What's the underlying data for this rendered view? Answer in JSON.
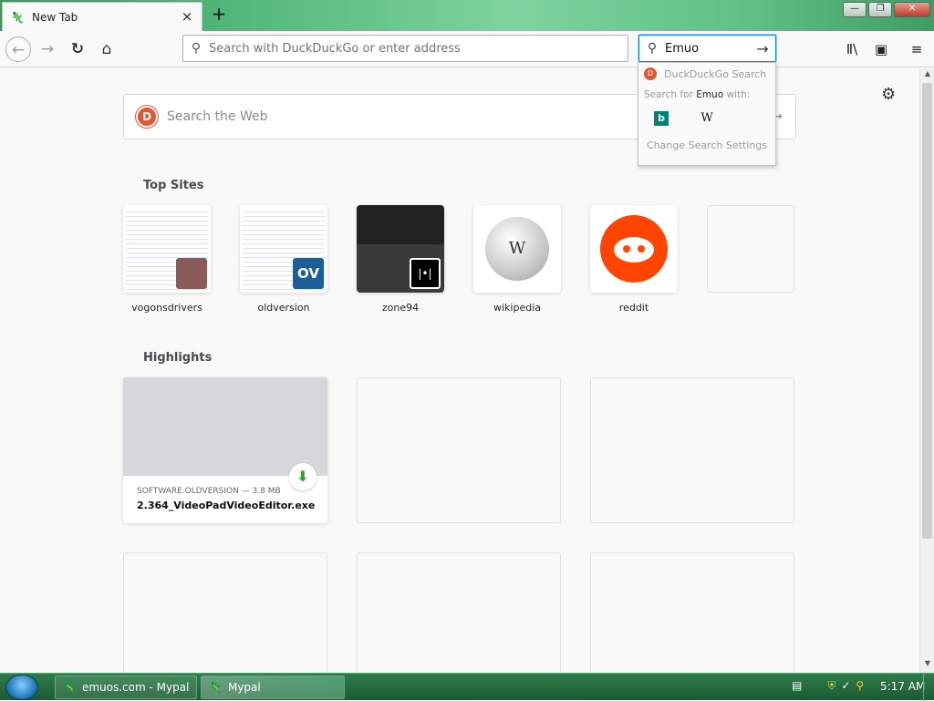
{
  "tab": {
    "icon": "emu-icon",
    "title": "New Tab",
    "close": "×"
  },
  "window": {
    "newtab": "+",
    "min": "—",
    "max": "❐",
    "close": "✕"
  },
  "nav": {
    "back": "←",
    "forward": "→",
    "reload": "↻",
    "home": "⌂",
    "url_placeholder": "Search with DuckDuckGo or enter address",
    "search_value": "Emuo",
    "search_go": "→",
    "library": "Ⅱ\\",
    "sidebar": "▣",
    "menu": "≡"
  },
  "dropdown": {
    "engine_name": "DuckDuckGo Search",
    "search_for_prefix": "Search for ",
    "search_term": "Emuo",
    "search_for_suffix": " with:",
    "engines": [
      "b",
      "W"
    ],
    "change": "Change Search Settings"
  },
  "newtab": {
    "gear": "⚙",
    "search_placeholder": "Search the Web",
    "search_go": "→",
    "top_sites_title": "Top Sites",
    "top_sites": [
      {
        "label": "vogonsdrivers"
      },
      {
        "label": "oldversion",
        "badge": "OV"
      },
      {
        "label": "zone94",
        "badge": "|•|"
      },
      {
        "label": "wikipedia",
        "glyph": "W"
      },
      {
        "label": "reddit"
      },
      {
        "label": ""
      }
    ],
    "highlights_title": "Highlights",
    "highlight": {
      "source": "SOFTWARE.OLDVERSION — 3.8 MB",
      "filename": "2.364_VideoPadVideoEditor.exe",
      "download_icon": "⬇"
    }
  },
  "taskbar": {
    "items": [
      "emuos.com - Mypal",
      "Mypal"
    ],
    "clock": "5:17 AM",
    "tray": [
      "▤",
      "⛨",
      "✓",
      "⚲",
      "⎙"
    ]
  },
  "colors": {
    "accent": "#0a84ff",
    "taskbar": "#2e7d4a",
    "ddg": "#de5833",
    "reddit": "#ff4500"
  }
}
